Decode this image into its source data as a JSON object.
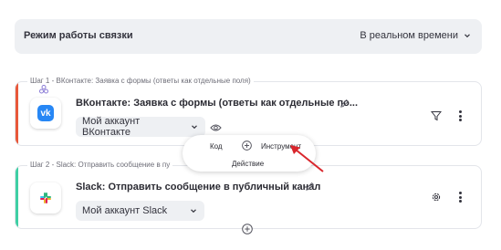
{
  "mode": {
    "label": "Режим работы связки",
    "value": "В реальном времени"
  },
  "steps": [
    {
      "caption": "Шаг 1 - ВКонтакте: Заявка с формы (ответы как отдельные поля)",
      "title": "ВКонтакте: Заявка с формы (ответы как отдельные по...",
      "account": "Мой аккаунт ВКонтакте",
      "accent": "#e8583a",
      "icon": "vk-logo-icon"
    },
    {
      "caption": "Шаг 2 - Slack: Отправить сообщение в пу",
      "title": "Slack: Отправить сообщение в публичный канал",
      "account": "Мой аккаунт Slack",
      "accent": "#3ecfa4",
      "icon": "slack-logo-icon"
    }
  ],
  "popup": {
    "code": "Код",
    "tool": "Инструмент",
    "action": "Действие"
  },
  "colors": {
    "annotation_arrow": "#d9262c",
    "vk_blue": "#2787f5"
  }
}
